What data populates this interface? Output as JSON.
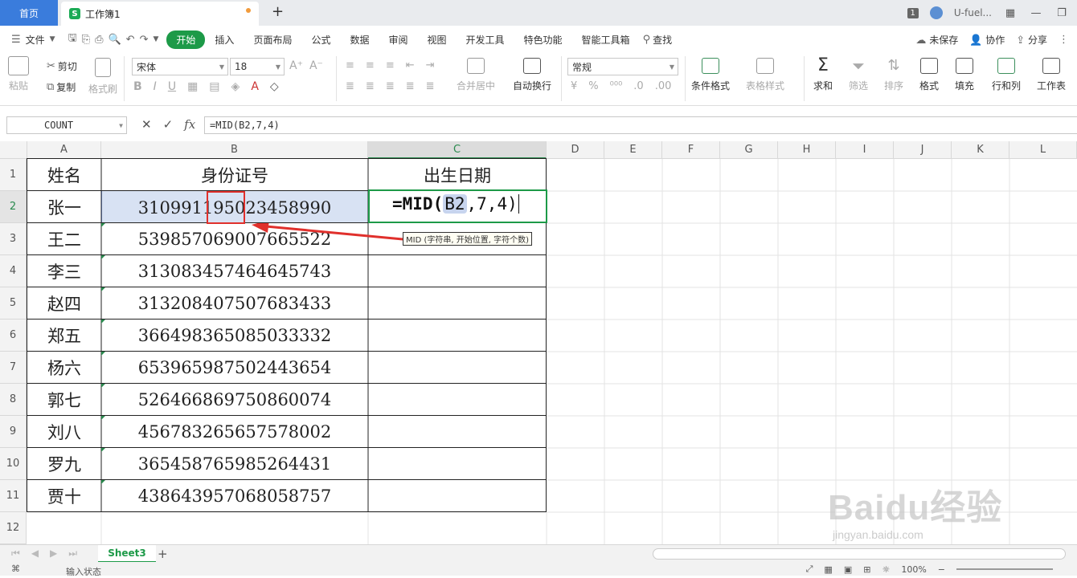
{
  "titlebar": {
    "home_tab": "首页",
    "doc_logo": "S",
    "doc_tab": "工作簿1",
    "window_count": "1",
    "user": "U-fuel...",
    "add_tab": "+"
  },
  "menubar": {
    "file": "文件",
    "tabs": [
      "开始",
      "插入",
      "页面布局",
      "公式",
      "数据",
      "审阅",
      "视图",
      "开发工具",
      "特色功能",
      "智能工具箱"
    ],
    "search": "查找",
    "unsaved": "未保存",
    "collab": "协作",
    "share": "分享"
  },
  "ribbon": {
    "paste": "粘贴",
    "cut": "剪切",
    "copy": "复制",
    "format_painter": "格式刷",
    "font_name": "宋体",
    "font_size": "18",
    "merge_center": "合并居中",
    "wrap_text": "自动换行",
    "number_format": "常规",
    "conditional_format": "条件格式",
    "table_style": "表格样式",
    "sum": "求和",
    "filter": "筛选",
    "sort": "排序",
    "format": "格式",
    "fill": "填充",
    "row_col": "行和列",
    "worksheet": "工作表"
  },
  "formula_bar": {
    "name_box": "COUNT",
    "formula": "=MID(B2,7,4)"
  },
  "columns": [
    "A",
    "B",
    "C",
    "D",
    "E",
    "F",
    "G",
    "H",
    "I",
    "J",
    "K",
    "L"
  ],
  "rows": [
    "1",
    "2",
    "3",
    "4",
    "5",
    "6",
    "7",
    "8",
    "9",
    "10",
    "11",
    "12"
  ],
  "table": {
    "headers": [
      "姓名",
      "身份证号",
      "出生日期"
    ],
    "names": [
      "张一",
      "王二",
      "李三",
      "赵四",
      "郑五",
      "杨六",
      "郭七",
      "刘八",
      "罗九",
      "贾十"
    ],
    "ids": [
      "310991195023458990",
      "539857069007665522",
      "313083457464645743",
      "313208407507683433",
      "366498365085033332",
      "653965987502443654",
      "526466869750860074",
      "456783265657578002",
      "365458765985264431",
      "438643957068058757"
    ]
  },
  "editing": {
    "prefix": "=MID(",
    "ref": "B2",
    "suffix": ",7,4)"
  },
  "tooltip": "MID (字符串, 开始位置, 字符个数)",
  "sheets": {
    "active": "Sheet3",
    "add": "+"
  },
  "status": {
    "mode": "输入状态",
    "zoom": "100%"
  },
  "watermark": {
    "main": "Baidu经验",
    "sub": "jingyan.baidu.com"
  },
  "colors": {
    "accent_green": "#1d9a48",
    "selection_blue": "#d8e2f3",
    "annotation_red": "#e0302c",
    "home_tab_blue": "#3a7cdc"
  }
}
